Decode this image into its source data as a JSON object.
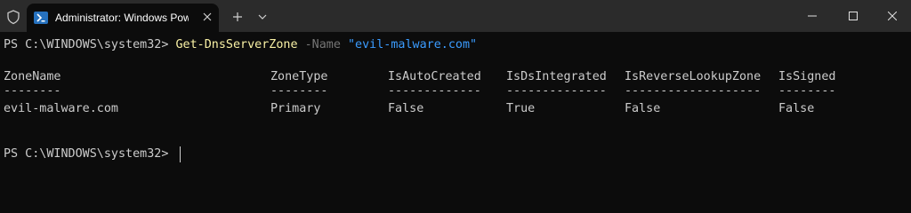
{
  "window": {
    "tab_title": "Administrator: Windows PowerShell",
    "new_tab_symbol": "+",
    "icons": [
      "shield-icon",
      "powershell-icon",
      "close-icon",
      "plus-icon",
      "chevron-down-icon",
      "minimize-icon",
      "maximize-icon",
      "close-window-icon"
    ]
  },
  "console": {
    "prompt1": "PS C:\\WINDOWS\\system32> ",
    "command": "Get-DnsServerZone",
    "param_name": " -Name ",
    "param_value": "\"evil-malware.com\"",
    "headers": [
      "ZoneName",
      "ZoneType",
      "IsAutoCreated",
      "IsDsIntegrated",
      "IsReverseLookupZone",
      "IsSigned"
    ],
    "separators": [
      "--------",
      "--------",
      "-------------",
      "--------------",
      "-------------------",
      "--------"
    ],
    "row": [
      "evil-malware.com",
      "Primary",
      "False",
      "True",
      "False",
      "False"
    ],
    "prompt2": "PS C:\\WINDOWS\\system32> "
  },
  "colors": {
    "background": "#0c0c0c",
    "titlebar": "#2b2b2b",
    "text": "#cccccc",
    "command": "#f9f1a5",
    "parameter": "#767676",
    "string": "#3b9cff"
  }
}
